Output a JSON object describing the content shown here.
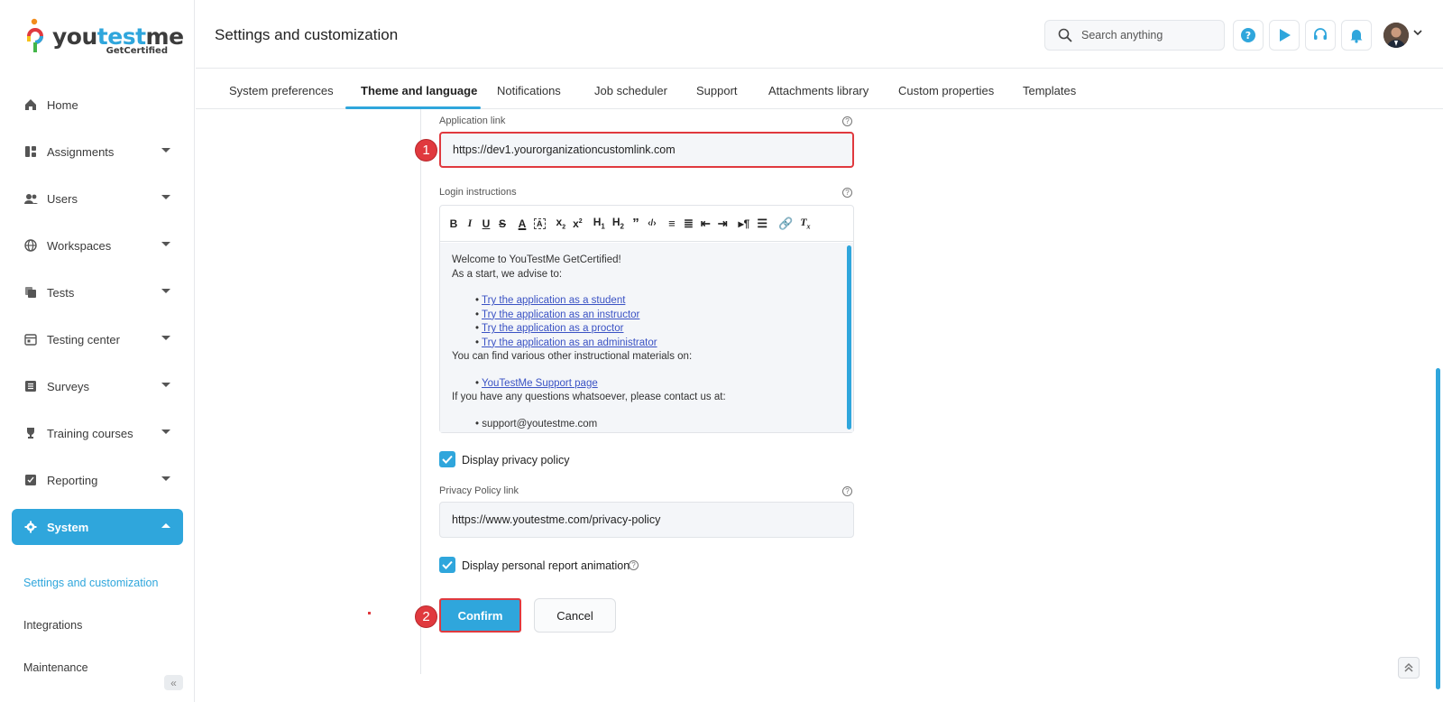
{
  "app": {
    "logo_main": "youtestme",
    "logo_sub": "GetCertified"
  },
  "sidebar": {
    "items": [
      {
        "label": "Home",
        "icon": "home-icon"
      },
      {
        "label": "Assignments",
        "icon": "assignments-icon"
      },
      {
        "label": "Users",
        "icon": "users-icon"
      },
      {
        "label": "Workspaces",
        "icon": "globe-icon"
      },
      {
        "label": "Tests",
        "icon": "tests-icon"
      },
      {
        "label": "Testing center",
        "icon": "calendar-icon"
      },
      {
        "label": "Surveys",
        "icon": "surveys-icon"
      },
      {
        "label": "Training courses",
        "icon": "trophy-icon"
      },
      {
        "label": "Reporting",
        "icon": "reporting-icon"
      },
      {
        "label": "System",
        "icon": "gear-icon"
      }
    ],
    "sub_items": [
      "Settings and customization",
      "Integrations",
      "Maintenance"
    ]
  },
  "header": {
    "title": "Settings and customization",
    "search_placeholder": "Search anything"
  },
  "tabs": [
    "System preferences",
    "Theme and language",
    "Notifications",
    "Job scheduler",
    "Support",
    "Attachments library",
    "Custom properties",
    "Templates"
  ],
  "form": {
    "app_link_label": "Application link",
    "app_link_value": "https://dev1.yourorganizationcustomlink.com",
    "login_label": "Login instructions",
    "login_content": {
      "line1": "Welcome to YouTestMe GetCertified!",
      "line2": "As a start, we advise to:",
      "links": [
        "Try the application as a student",
        "Try the application as an instructor",
        "Try the application as a proctor",
        "Try the application as an administrator"
      ],
      "line3": "You can find various other instructional materials on:",
      "support_link": "YouTestMe Support page",
      "line4": "If you have any questions whatsoever, please contact us at:",
      "email": "support@youtestme.com"
    },
    "display_privacy_label": "Display privacy policy",
    "privacy_link_label": "Privacy Policy link",
    "privacy_link_value": "https://www.youtestme.com/privacy-policy",
    "display_animation_label": "Display personal report animation",
    "confirm_label": "Confirm",
    "cancel_label": "Cancel"
  },
  "badges": {
    "one": "1",
    "two": "2"
  },
  "colors": {
    "accent": "#2fa6dc",
    "highlight": "#e0393e"
  }
}
